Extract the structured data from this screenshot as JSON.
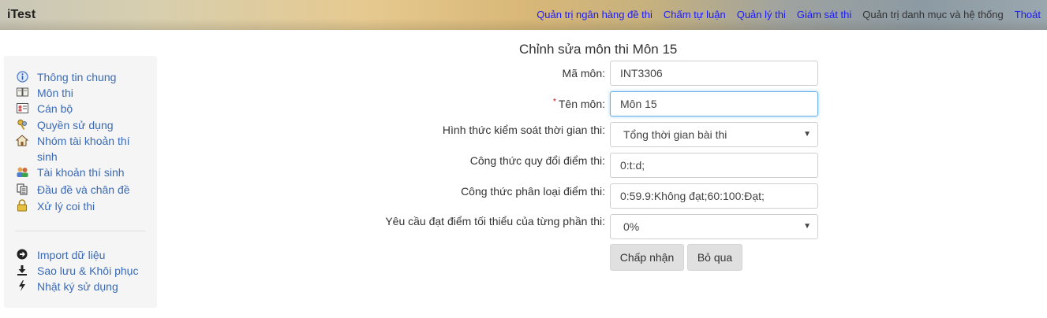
{
  "app": {
    "brand": "iTest"
  },
  "topnav": [
    {
      "label": "Quản trị ngân hàng đề thi"
    },
    {
      "label": "Chấm tự luận"
    },
    {
      "label": "Quản lý thi"
    },
    {
      "label": "Giám sát thi"
    },
    {
      "label": "Quản trị danh mục và hệ thống"
    },
    {
      "label": "Thoát"
    }
  ],
  "sidebar": {
    "items": [
      {
        "label": "Thông tin chung",
        "icon": "info-icon"
      },
      {
        "label": "Môn thi",
        "icon": "book-icon"
      },
      {
        "label": "Cán bộ",
        "icon": "id-card-icon"
      },
      {
        "label": "Quyền sử dụng",
        "icon": "keys-icon"
      },
      {
        "label": "Nhóm tài khoản thí sinh",
        "icon": "house-icon"
      },
      {
        "label": "Tài khoản thí sinh",
        "icon": "users-icon"
      },
      {
        "label": "Đầu đề và chân đề",
        "icon": "documents-icon"
      },
      {
        "label": "Xử lý coi thi",
        "icon": "lock-icon"
      }
    ],
    "tools": [
      {
        "label": "Import dữ liệu",
        "icon": "arrow-circle-icon"
      },
      {
        "label": "Sao lưu & Khôi phục",
        "icon": "download-icon"
      },
      {
        "label": "Nhật ký sử dụng",
        "icon": "bolt-icon"
      }
    ]
  },
  "form": {
    "title": "Chỉnh sửa môn thi Môn 15",
    "fields": {
      "ma_mon": {
        "label": "Mã môn:",
        "value": "INT3306"
      },
      "ten_mon": {
        "label": "Tên môn:",
        "required_mark": "*",
        "value": "Môn 15"
      },
      "hinh_thuc": {
        "label": "Hình thức kiểm soát thời gian thi:",
        "value": "Tổng thời gian bài thi"
      },
      "cong_thuc_quy_doi": {
        "label": "Công thức quy đổi điểm thi:",
        "value": "0:t:d;"
      },
      "cong_thuc_phan_loai": {
        "label": "Công thức phân loại điểm thi:",
        "value": "0:59.9:Không đạt;60:100:Đạt;"
      },
      "yeu_cau_toi_thieu": {
        "label": "Yêu cầu đạt điểm tối thiểu của từng phần thi:",
        "value": "0%"
      }
    },
    "buttons": {
      "accept": "Chấp nhận",
      "cancel": "Bỏ qua"
    }
  },
  "colors": {
    "link": "#1a1aff",
    "sidebar_link": "#3a6ab5",
    "focus": "#66afe9"
  }
}
